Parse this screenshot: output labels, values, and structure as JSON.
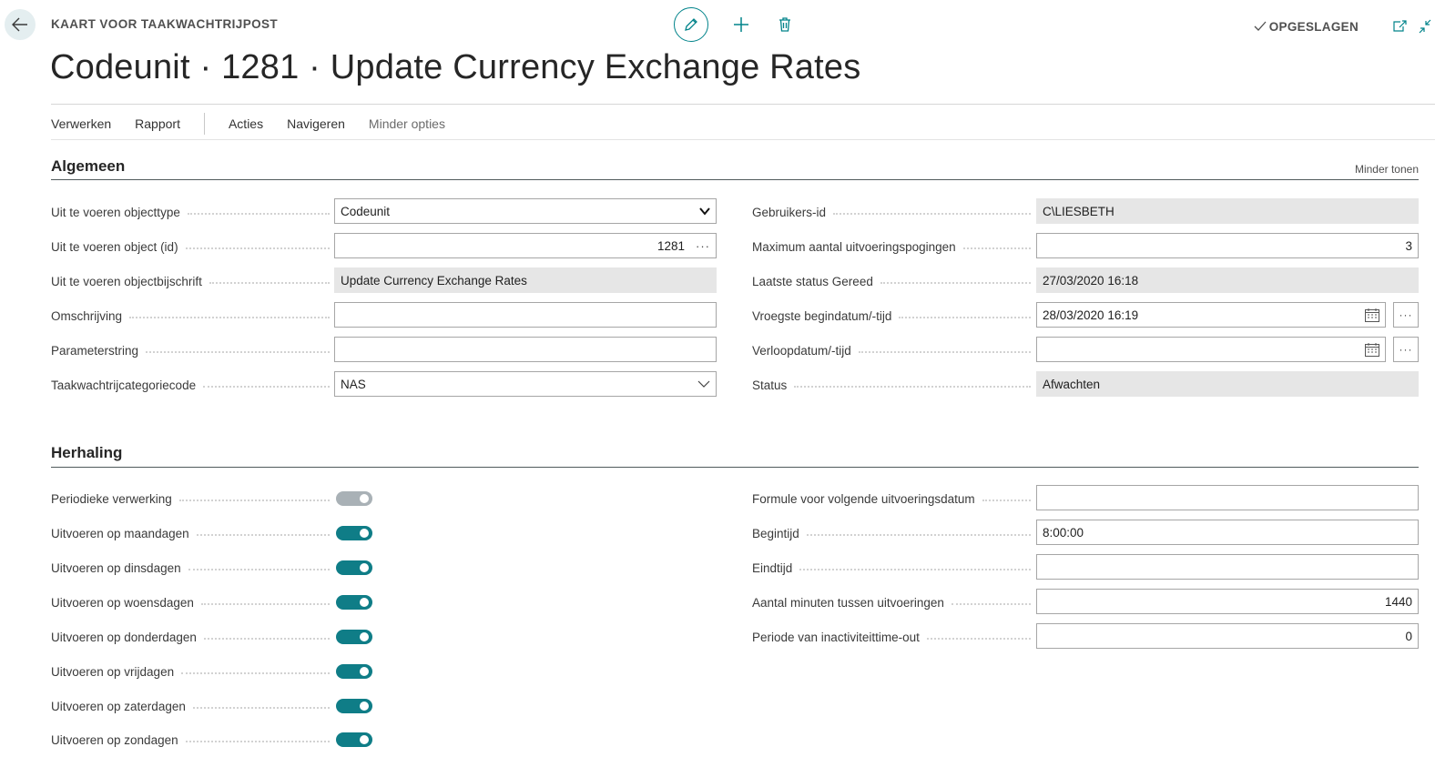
{
  "header": {
    "caption": "KAART VOOR TAAKWACHTRIJPOST",
    "title": "Codeunit · 1281 · Update Currency Exchange Rates",
    "saved_label": "OPGESLAGEN"
  },
  "actionbar": {
    "items": [
      "Verwerken",
      "Rapport",
      "Acties",
      "Navigeren",
      "Minder opties"
    ]
  },
  "algemeen": {
    "title": "Algemeen",
    "less_link": "Minder tonen",
    "left": [
      {
        "label": "Uit te voeren objecttype",
        "value": "Codeunit"
      },
      {
        "label": "Uit te voeren object (id)",
        "value": "1281"
      },
      {
        "label": "Uit te voeren objectbijschrift",
        "value": "Update Currency Exchange Rates"
      },
      {
        "label": "Omschrijving",
        "value": ""
      },
      {
        "label": "Parameterstring",
        "value": ""
      },
      {
        "label": "Taakwachtrijcategoriecode",
        "value": "NAS"
      }
    ],
    "right": [
      {
        "label": "Gebruikers-id",
        "value": "C\\LIESBETH"
      },
      {
        "label": "Maximum aantal uitvoeringspogingen",
        "value": "3"
      },
      {
        "label": "Laatste status Gereed",
        "value": "27/03/2020 16:18"
      },
      {
        "label": "Vroegste begindatum/-tijd",
        "value": "28/03/2020 16:19"
      },
      {
        "label": "Verloopdatum/-tijd",
        "value": ""
      },
      {
        "label": "Status",
        "value": "Afwachten"
      }
    ]
  },
  "herhaling": {
    "title": "Herhaling",
    "toggles": [
      {
        "label": "Periodieke verwerking",
        "on": false
      },
      {
        "label": "Uitvoeren op maandagen",
        "on": true
      },
      {
        "label": "Uitvoeren op dinsdagen",
        "on": true
      },
      {
        "label": "Uitvoeren op woensdagen",
        "on": true
      },
      {
        "label": "Uitvoeren op donderdagen",
        "on": true
      },
      {
        "label": "Uitvoeren op vrijdagen",
        "on": true
      },
      {
        "label": "Uitvoeren op zaterdagen",
        "on": true
      },
      {
        "label": "Uitvoeren op zondagen",
        "on": true
      }
    ],
    "right": [
      {
        "label": "Formule voor volgende uitvoeringsdatum",
        "value": ""
      },
      {
        "label": "Begintijd",
        "value": "8:00:00"
      },
      {
        "label": "Eindtijd",
        "value": ""
      },
      {
        "label": "Aantal minuten tussen uitvoeringen",
        "value": "1440"
      },
      {
        "label": "Periode van inactiviteittime-out",
        "value": "0"
      }
    ]
  },
  "colors": {
    "accent": "#0f7d87",
    "toggle_off": "#a9b1b6"
  }
}
